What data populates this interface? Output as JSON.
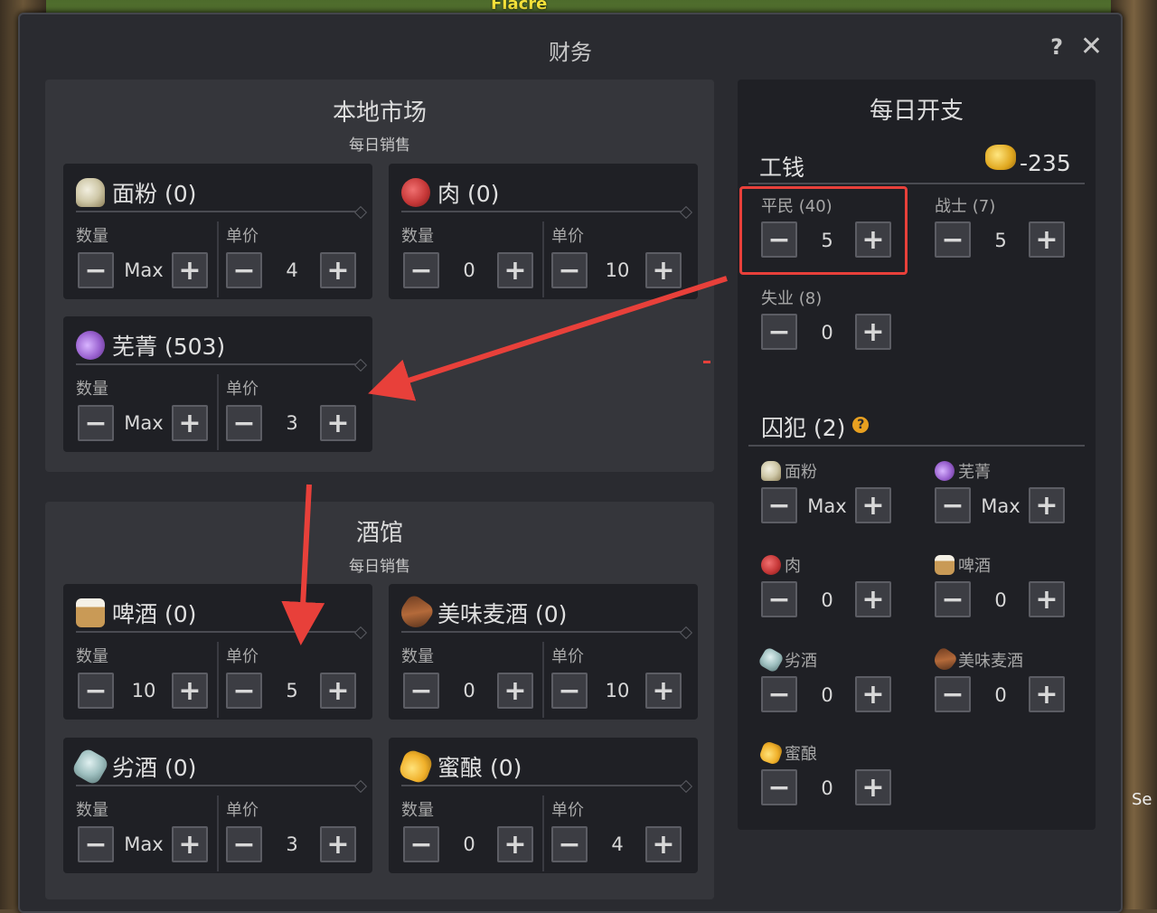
{
  "game": {
    "town_label": "Fiacre",
    "edge_text": "Se"
  },
  "window": {
    "title": "财务",
    "help": "?",
    "close": "✕"
  },
  "local_market": {
    "title": "本地市场",
    "subtitle": "每日销售",
    "items": [
      {
        "icon": "flour-icon",
        "label": "面粉 (0)",
        "qty_label": "数量",
        "price_label": "单价",
        "qty": "Max",
        "price": "4"
      },
      {
        "icon": "meat-icon",
        "label": "肉 (0)",
        "qty_label": "数量",
        "price_label": "单价",
        "qty": "0",
        "price": "10"
      },
      {
        "icon": "turnip-icon",
        "label": "芜菁 (503)",
        "qty_label": "数量",
        "price_label": "单价",
        "qty": "Max",
        "price": "3"
      }
    ]
  },
  "tavern": {
    "title": "酒馆",
    "subtitle": "每日销售",
    "items": [
      {
        "icon": "beer-icon",
        "label": "啤酒 (0)",
        "qty_label": "数量",
        "price_label": "单价",
        "qty": "10",
        "price": "5"
      },
      {
        "icon": "tasty-ale-icon",
        "label": "美味麦酒 (0)",
        "qty_label": "数量",
        "price_label": "单价",
        "qty": "0",
        "price": "10"
      },
      {
        "icon": "bad-wine-icon",
        "label": "劣酒 (0)",
        "qty_label": "数量",
        "price_label": "单价",
        "qty": "Max",
        "price": "3"
      },
      {
        "icon": "mead-icon",
        "label": "蜜酿 (0)",
        "qty_label": "数量",
        "price_label": "单价",
        "qty": "0",
        "price": "4"
      }
    ]
  },
  "daily_expenses": {
    "title": "每日开支",
    "wages": {
      "label": "工钱",
      "total": "-235",
      "groups": [
        {
          "label": "平民 (40)",
          "value": "5"
        },
        {
          "label": "战士 (7)",
          "value": "5"
        },
        {
          "label": "失业 (8)",
          "value": "0"
        }
      ]
    },
    "prisoners": {
      "label": "囚犯 (2)",
      "help": "?",
      "items": [
        {
          "icon": "flour-icon",
          "label": "面粉",
          "value": "Max"
        },
        {
          "icon": "turnip-icon",
          "label": "芜菁",
          "value": "Max"
        },
        {
          "icon": "meat-icon",
          "label": "肉",
          "value": "0"
        },
        {
          "icon": "beer-icon",
          "label": "啤酒",
          "value": "0"
        },
        {
          "icon": "bad-wine-icon",
          "label": "劣酒",
          "value": "0"
        },
        {
          "icon": "tasty-ale-icon",
          "label": "美味麦酒",
          "value": "0"
        },
        {
          "icon": "mead-icon",
          "label": "蜜酿",
          "value": "0"
        }
      ]
    }
  },
  "colors": {
    "highlight": "#e8403a",
    "panel": "#35363b",
    "card": "#1f2025",
    "window": "#2a2b30"
  }
}
